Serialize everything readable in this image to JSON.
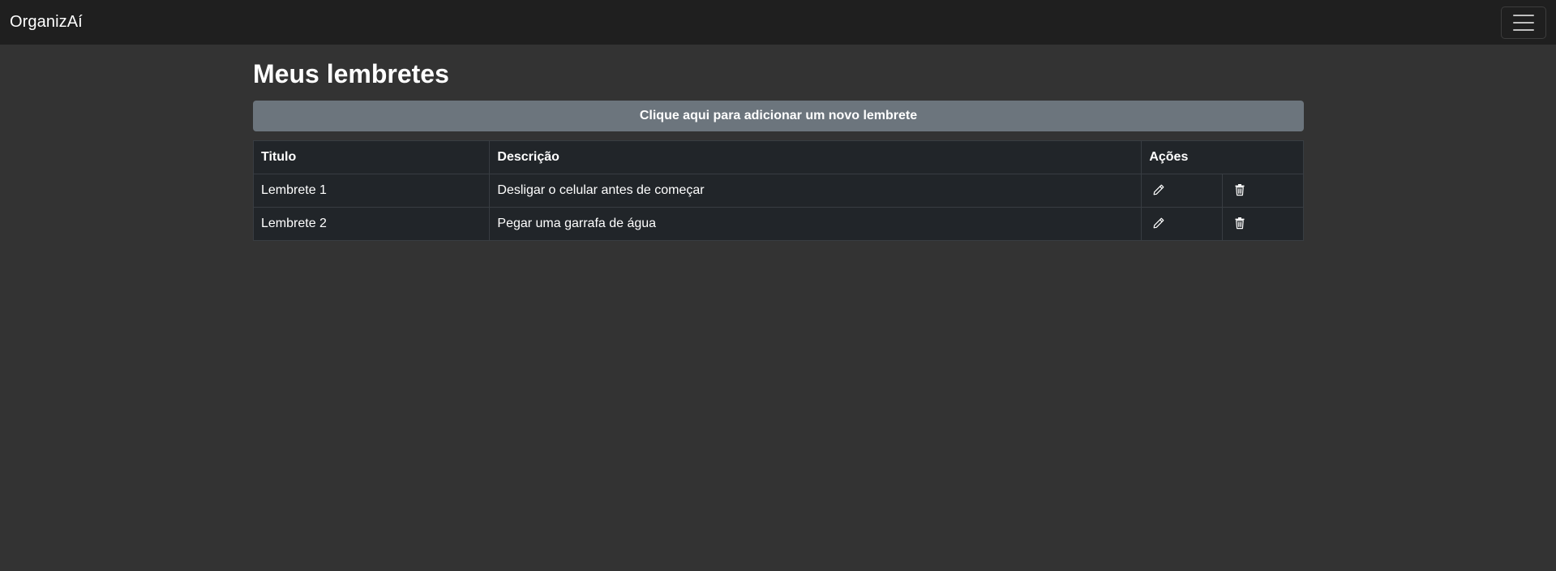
{
  "navbar": {
    "brand": "OrganizAí",
    "toggle_icon": "hamburger-icon"
  },
  "main": {
    "title": "Meus lembretes",
    "add_button_label": "Clique aqui para adicionar um novo lembrete"
  },
  "table": {
    "headers": {
      "title": "Titulo",
      "description": "Descrição",
      "actions": "Ações"
    },
    "rows": [
      {
        "title": "Lembrete 1",
        "description": "Desligar o celular antes de começar",
        "edit_icon": "pencil-icon",
        "delete_icon": "trash-icon"
      },
      {
        "title": "Lembrete 2",
        "description": "Pegar uma garrafa de água",
        "edit_icon": "pencil-icon",
        "delete_icon": "trash-icon"
      }
    ]
  },
  "colors": {
    "navbar_bg": "#1f1f1f",
    "page_bg": "#333333",
    "button_bg": "#6c757d",
    "table_bg": "#212529"
  }
}
